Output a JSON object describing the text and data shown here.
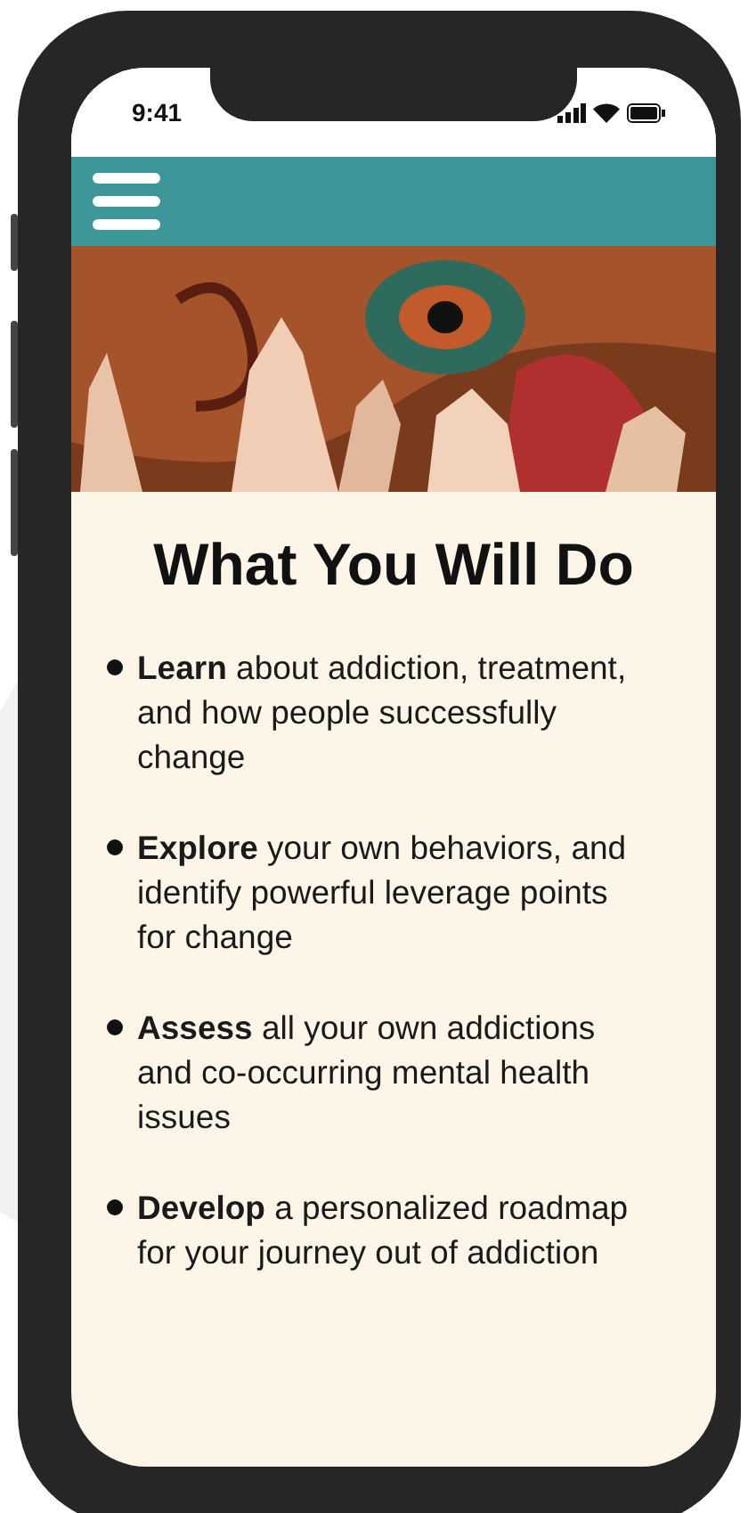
{
  "status_bar": {
    "time": "9:41"
  },
  "title": "What You Will Do",
  "items": [
    {
      "text": "**Learn** about addiction, treatment, and how people successfully change"
    },
    {
      "text": "**Explore** your own behaviors, and identify powerful leverage points for change"
    },
    {
      "text": "**Assess** all your own addictions and co-occurring mental health issues"
    },
    {
      "text": "**Develop** a personalized roadmap for your journey out of addiction"
    }
  ]
}
